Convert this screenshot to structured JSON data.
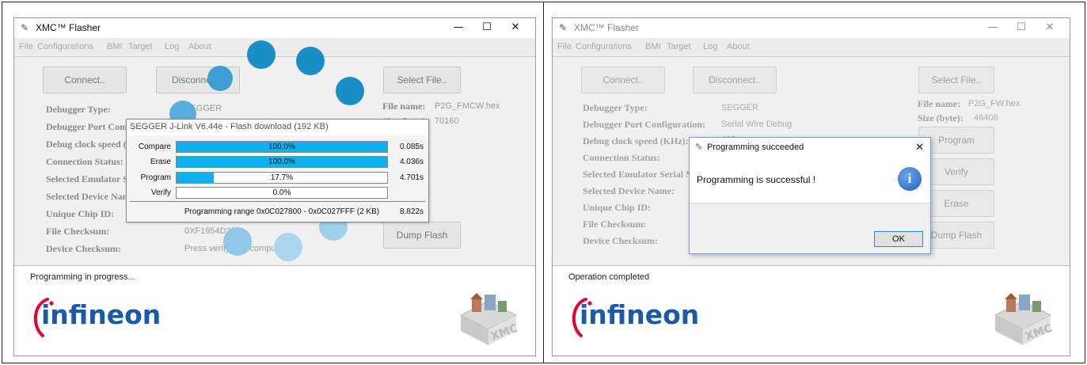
{
  "left_window": {
    "title": "XMC™ Flasher",
    "menu": [
      "File",
      "Configurations",
      "BMI",
      "Target",
      "Log",
      "About"
    ],
    "buttons": {
      "connect": "Connect..",
      "disconnect": "Disconnect..",
      "select_file": "Select File..",
      "dump_flash": "Dump Flash"
    },
    "labels": {
      "debugger_type": "Debugger Type:",
      "debugger_port": "Debugger Port Confi",
      "debug_clock": "Debug clock speed (K",
      "connection_status": "Connection Status:",
      "selected_emulator": "Selected Emulator Se",
      "selected_device": "Selected Device Nam",
      "unique_chip_id": "Unique Chip ID:",
      "file_checksum": "File Checksum:",
      "device_checksum": "Device Checksum:"
    },
    "values": {
      "debugger_type": "SEGGER",
      "file_checksum": "0XF1954D3D",
      "device_checksum": "Press verify to recompute.."
    },
    "file_info": {
      "name_label": "File name:",
      "name_value": "P2G_FMCW.hex",
      "size_label": "Size (byte):",
      "size_value": "70160"
    },
    "status_text": "Programming in progress...",
    "logo_text": "infineon",
    "jlink": {
      "title": "SEGGER J-Link V6.44e - Flash download (192 KB)",
      "rows": [
        {
          "name": "Compare",
          "percent": "100.0%",
          "progress": 1.0,
          "time": "0.085s"
        },
        {
          "name": "Erase",
          "percent": "100.0%",
          "progress": 1.0,
          "time": "4.036s"
        },
        {
          "name": "Program",
          "percent": "17.7%",
          "progress": 0.177,
          "time": "4.701s"
        },
        {
          "name": "Verify",
          "percent": "0.0%",
          "progress": 0.0,
          "time": ""
        }
      ],
      "range": "Programming range 0x0C027800 - 0x0C027FFF (2 KB)",
      "total": "8.822s"
    }
  },
  "right_window": {
    "title": "XMC™ Flasher",
    "menu": [
      "File",
      "Configurations",
      "BMI",
      "Target",
      "Log",
      "About"
    ],
    "buttons": {
      "connect": "Connect..",
      "disconnect": "Disconnect..",
      "select_file": "Select File..",
      "program": "Program",
      "verify": "Verify",
      "erase": "Erase",
      "dump_flash": "Dump Flash"
    },
    "labels": {
      "debugger_type": "Debugger Type:",
      "debugger_port": "Debugger Port Configuration:",
      "debug_clock": "Debug clock speed (KHz):",
      "connection_status": "Connection Status:",
      "selected_emulator": "Selected Emulator Serial Nu",
      "selected_device": "Selected Device Name:",
      "unique_chip_id": "Unique Chip ID:",
      "file_checksum": "File Checksum:",
      "device_checksum": "Device Checksum:"
    },
    "values": {
      "debugger_type": "SEGGER",
      "debugger_port": "Serial Wire Debug",
      "debug_clock": "400"
    },
    "file_info": {
      "name_label": "File name:",
      "name_value": "P2G_FW.hex",
      "size_label": "Size (byte):",
      "size_value": "46408"
    },
    "status_text": "Operation completed",
    "logo_text": "infineon",
    "dialog": {
      "title": "Programming succeeded",
      "message": "Programming is successful !",
      "info_glyph": "i",
      "ok": "OK"
    }
  },
  "colors": {
    "spinner_blue": "#1a8fc7",
    "progress_fill": "#0fb0f0",
    "infineon_blue": "#1b5aa8",
    "infineon_red": "#e30034"
  },
  "icons": [
    "app-icon",
    "minimize-icon",
    "maximize-icon",
    "close-icon",
    "info-icon",
    "xmc-logo-icon",
    "loading-spinner"
  ]
}
